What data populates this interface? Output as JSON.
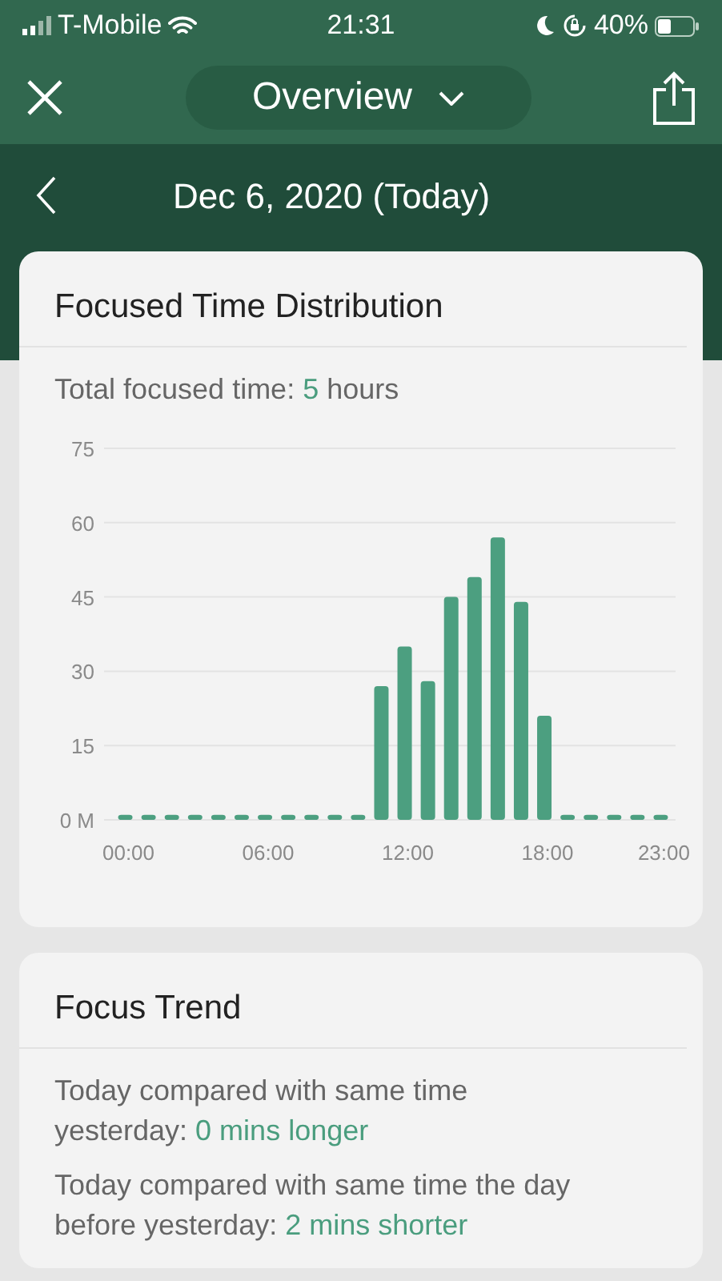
{
  "status_bar": {
    "carrier": "T-Mobile",
    "time": "21:31",
    "battery": "40%"
  },
  "header": {
    "title": "Overview"
  },
  "date_nav": {
    "date": "Dec 6, 2020 (Today)"
  },
  "distribution": {
    "title": "Focused Time Distribution",
    "summary": [
      {
        "text": "Total focused time: ",
        "highlight": false
      },
      {
        "text": "5",
        "highlight": true
      },
      {
        "text": " hours",
        "highlight": false
      }
    ],
    "chart_data": {
      "type": "bar",
      "x": [
        0,
        1,
        2,
        3,
        4,
        5,
        6,
        7,
        8,
        9,
        10,
        11,
        12,
        13,
        14,
        15,
        16,
        17,
        18,
        19,
        20,
        21,
        22,
        23
      ],
      "values": [
        1,
        1,
        1,
        1,
        1,
        1,
        1,
        1,
        1,
        1,
        1,
        27,
        35,
        28,
        45,
        49,
        57,
        44,
        21,
        1,
        1,
        1,
        1,
        1
      ],
      "xlim": [
        -0.5,
        23.5
      ],
      "ylim": [
        0,
        75
      ],
      "grid": true,
      "yticks": [
        {
          "value": 0,
          "label": "0 M"
        },
        15,
        30,
        45,
        60,
        75
      ],
      "xticks": [
        {
          "value": 0,
          "label": "00:00"
        },
        {
          "value": 6,
          "label": "06:00"
        },
        {
          "value": 12,
          "label": "12:00"
        },
        {
          "value": 18,
          "label": "18:00"
        },
        {
          "value": 23,
          "label": "23:00"
        }
      ]
    }
  },
  "trend": {
    "title": "Focus Trend",
    "items": [
      [
        {
          "text": "Today compared with same time yesterday: ",
          "highlight": false
        },
        {
          "text": "0 mins longer",
          "highlight": true
        }
      ],
      [
        {
          "text": "Today compared with same time the day before yesterday: ",
          "highlight": false
        },
        {
          "text": "2 mins shorter",
          "highlight": true
        }
      ]
    ]
  }
}
